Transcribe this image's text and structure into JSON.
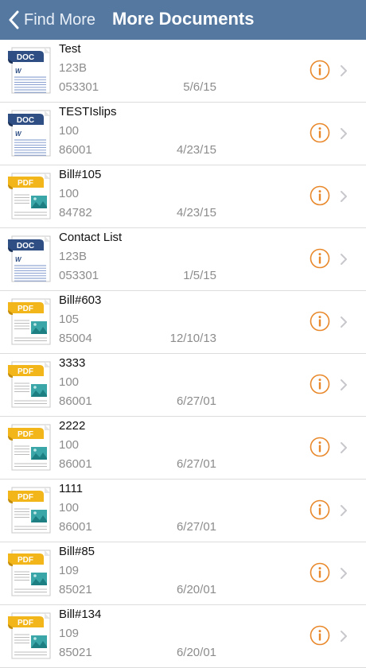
{
  "nav": {
    "back_label": "Find More",
    "title": "More Documents"
  },
  "colors": {
    "navbar": "#5578a1",
    "accent_orange": "#e8882a",
    "doc_badge": "#2f4f84",
    "pdf_badge": "#f2b51a"
  },
  "documents": [
    {
      "type": "DOC",
      "name": "Test",
      "code": "123B",
      "number": "053301",
      "date": "5/6/15"
    },
    {
      "type": "DOC",
      "name": "TESTIslips",
      "code": "100",
      "number": "86001",
      "date": "4/23/15"
    },
    {
      "type": "PDF",
      "name": "Bill#105",
      "code": "100",
      "number": "84782",
      "date": "4/23/15"
    },
    {
      "type": "DOC",
      "name": "Contact List",
      "code": "123B",
      "number": "053301",
      "date": "1/5/15"
    },
    {
      "type": "PDF",
      "name": "Bill#603",
      "code": "105",
      "number": "85004",
      "date": "12/10/13"
    },
    {
      "type": "PDF",
      "name": "3333",
      "code": "100",
      "number": "86001",
      "date": "6/27/01"
    },
    {
      "type": "PDF",
      "name": "2222",
      "code": "100",
      "number": "86001",
      "date": "6/27/01"
    },
    {
      "type": "PDF",
      "name": "1111",
      "code": "100",
      "number": "86001",
      "date": "6/27/01"
    },
    {
      "type": "PDF",
      "name": "Bill#85",
      "code": "109",
      "number": "85021",
      "date": "6/20/01"
    },
    {
      "type": "PDF",
      "name": "Bill#134",
      "code": "109",
      "number": "85021",
      "date": "6/20/01"
    }
  ]
}
